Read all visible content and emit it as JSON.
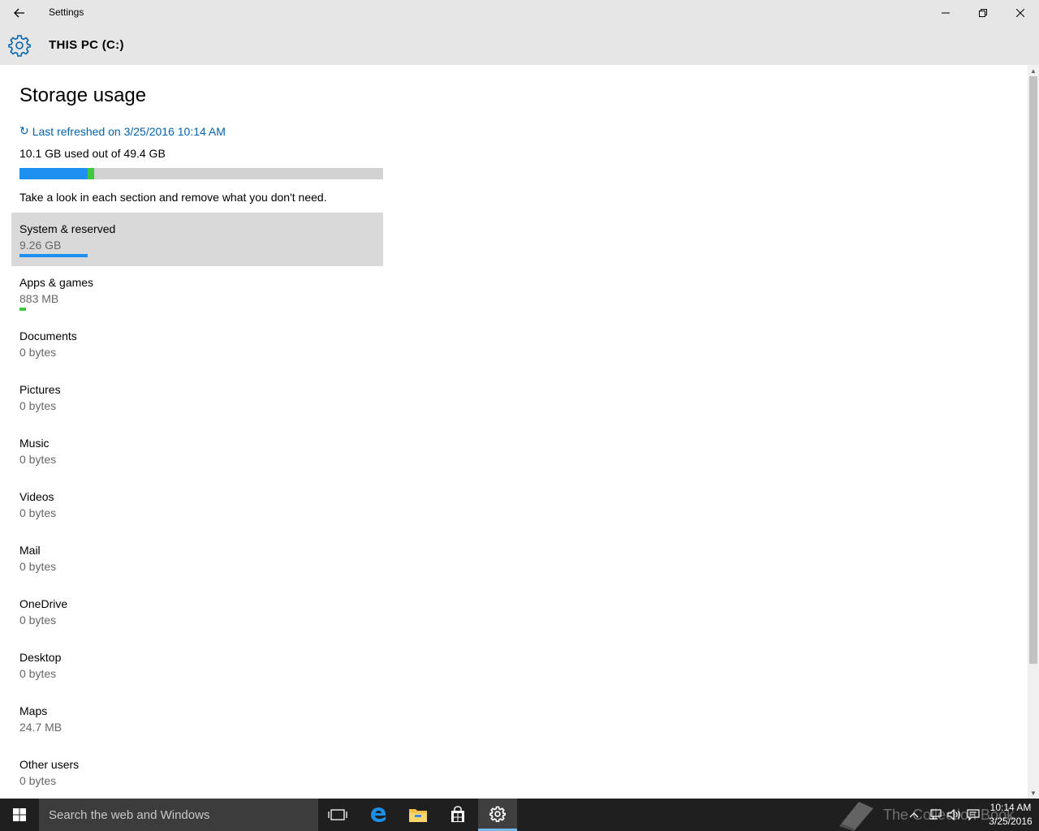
{
  "window": {
    "title": "Settings",
    "back_icon": "back-arrow-icon",
    "controls": [
      "minimize-icon",
      "restore-icon",
      "close-icon"
    ]
  },
  "header": {
    "icon": "gear-icon",
    "title": "THIS PC (C:)"
  },
  "main": {
    "page_title": "Storage usage",
    "refresh_icon": "refresh-icon",
    "refresh_label": "Last refreshed on 3/25/2016 10:14 AM",
    "usage_summary": "10.1 GB used out of 49.4 GB",
    "usage_bar": {
      "total_gb": 49.4,
      "segments": [
        {
          "name": "System & reserved",
          "fraction": 0.1875,
          "color": "#1e90f0"
        },
        {
          "name": "Apps & games",
          "fraction": 0.018,
          "color": "#3dc83d"
        }
      ]
    },
    "hint": "Take a look in each section and remove what you don't need.",
    "categories": [
      {
        "name": "System & reserved",
        "size": "9.26 GB",
        "fraction": 0.1875,
        "color": "#1e90f0",
        "selected": true
      },
      {
        "name": "Apps & games",
        "size": "883 MB",
        "fraction": 0.018,
        "color": "#3dc83d",
        "selected": false
      },
      {
        "name": "Documents",
        "size": "0 bytes",
        "fraction": 0,
        "color": "#1e90f0",
        "selected": false
      },
      {
        "name": "Pictures",
        "size": "0 bytes",
        "fraction": 0,
        "color": "#1e90f0",
        "selected": false
      },
      {
        "name": "Music",
        "size": "0 bytes",
        "fraction": 0,
        "color": "#1e90f0",
        "selected": false
      },
      {
        "name": "Videos",
        "size": "0 bytes",
        "fraction": 0,
        "color": "#1e90f0",
        "selected": false
      },
      {
        "name": "Mail",
        "size": "0 bytes",
        "fraction": 0,
        "color": "#1e90f0",
        "selected": false
      },
      {
        "name": "OneDrive",
        "size": "0 bytes",
        "fraction": 0,
        "color": "#1e90f0",
        "selected": false
      },
      {
        "name": "Desktop",
        "size": "0 bytes",
        "fraction": 0,
        "color": "#1e90f0",
        "selected": false
      },
      {
        "name": "Maps",
        "size": "24.7 MB",
        "fraction": 0,
        "color": "#1e90f0",
        "selected": false
      },
      {
        "name": "Other users",
        "size": "0 bytes",
        "fraction": 0,
        "color": "#1e90f0",
        "selected": false
      }
    ]
  },
  "taskbar": {
    "start_icon": "windows-logo-icon",
    "search_placeholder": "Search the web and Windows",
    "pinned": [
      "task-view-icon",
      "edge-icon",
      "file-explorer-icon",
      "store-icon",
      "settings-icon"
    ],
    "active": "settings-icon",
    "watermark": "The Collection Book",
    "tray_icons": [
      "chevron-up-icon",
      "network-icon",
      "volume-icon",
      "action-center-icon"
    ],
    "clock_time": "10:14 AM",
    "clock_date": "3/25/2016"
  },
  "colors": {
    "accent": "#0063b1",
    "chrome": "#e6e6e6",
    "selected_row": "#d9d9d9",
    "system_bar": "#1e90f0",
    "apps_bar": "#3dc83d",
    "taskbar": "#1f1f1f"
  }
}
